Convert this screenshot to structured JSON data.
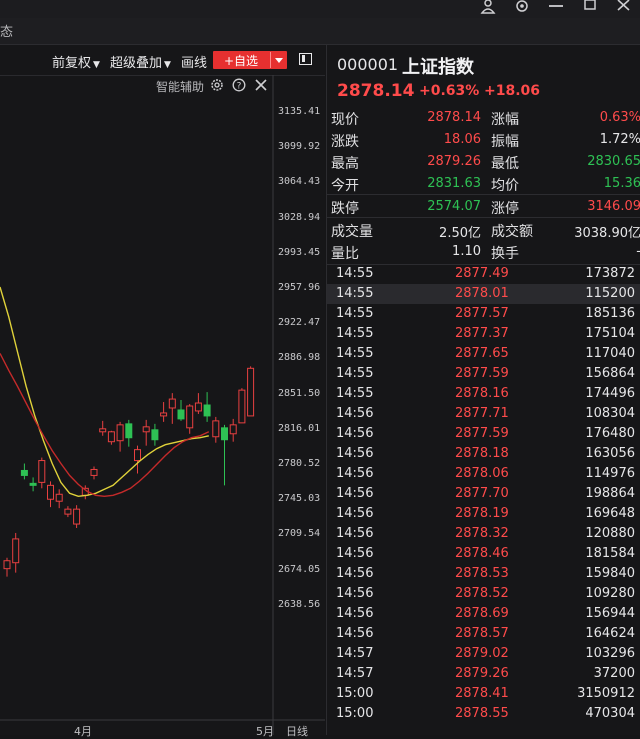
{
  "tab_label": "态",
  "toolbar": {
    "adjust": "前复权",
    "overlay": "超级叠加",
    "draw": "画线",
    "add_watch": "+自选",
    "assist": "智能辅助"
  },
  "price_axis": [
    "3135.41",
    "3099.92",
    "3064.43",
    "3028.94",
    "2993.45",
    "2957.96",
    "2922.47",
    "2886.98",
    "2851.50",
    "2816.01",
    "2780.52",
    "2745.03",
    "2709.54",
    "2674.05",
    "2638.56"
  ],
  "x_axis": {
    "month1": "4月",
    "month2": "5月",
    "period": "日线"
  },
  "stock": {
    "code": "000001",
    "name": "上证指数",
    "price": "2878.14",
    "change_pct": "+0.63%",
    "change_amt": "+18.06"
  },
  "quote_rows": [
    {
      "l1": "现价",
      "v1": "2878.14",
      "c1": "red",
      "l2": "涨幅",
      "v2": "0.63%",
      "c2": "red"
    },
    {
      "l1": "涨跌",
      "v1": "18.06",
      "c1": "red",
      "l2": "振幅",
      "v2": "1.72%",
      "c2": "white"
    },
    {
      "l1": "最高",
      "v1": "2879.26",
      "c1": "red",
      "l2": "最低",
      "v2": "2830.65",
      "c2": "green"
    },
    {
      "l1": "今开",
      "v1": "2831.63",
      "c1": "green",
      "l2": "均价",
      "v2": "15.36",
      "c2": "green"
    },
    {
      "l1": "跌停",
      "v1": "2574.07",
      "c1": "green",
      "l2": "涨停",
      "v2": "3146.09",
      "c2": "red"
    },
    {
      "l1": "成交量",
      "v1": "2.50亿",
      "c1": "white",
      "l2": "成交额",
      "v2": "3038.90亿",
      "c2": "white"
    },
    {
      "l1": "量比",
      "v1": "1.10",
      "c1": "white",
      "l2": "换手",
      "v2": "-",
      "c2": "white"
    }
  ],
  "ticks": [
    {
      "t": "14:55",
      "p": "2877.49",
      "v": "173872"
    },
    {
      "t": "14:55",
      "p": "2878.01",
      "v": "115200"
    },
    {
      "t": "14:55",
      "p": "2877.57",
      "v": "185136"
    },
    {
      "t": "14:55",
      "p": "2877.37",
      "v": "175104"
    },
    {
      "t": "14:55",
      "p": "2877.65",
      "v": "117040"
    },
    {
      "t": "14:55",
      "p": "2877.59",
      "v": "156864"
    },
    {
      "t": "14:55",
      "p": "2878.16",
      "v": "174496"
    },
    {
      "t": "14:56",
      "p": "2877.71",
      "v": "108304"
    },
    {
      "t": "14:56",
      "p": "2877.59",
      "v": "176480"
    },
    {
      "t": "14:56",
      "p": "2878.18",
      "v": "163056"
    },
    {
      "t": "14:56",
      "p": "2878.06",
      "v": "114976"
    },
    {
      "t": "14:56",
      "p": "2877.70",
      "v": "198864"
    },
    {
      "t": "14:56",
      "p": "2878.19",
      "v": "169648"
    },
    {
      "t": "14:56",
      "p": "2878.32",
      "v": "120880"
    },
    {
      "t": "14:56",
      "p": "2878.46",
      "v": "181584"
    },
    {
      "t": "14:56",
      "p": "2878.53",
      "v": "159840"
    },
    {
      "t": "14:56",
      "p": "2878.52",
      "v": "109280"
    },
    {
      "t": "14:56",
      "p": "2878.69",
      "v": "156944"
    },
    {
      "t": "14:56",
      "p": "2878.57",
      "v": "164624"
    },
    {
      "t": "14:57",
      "p": "2879.02",
      "v": "103296"
    },
    {
      "t": "14:57",
      "p": "2879.26",
      "v": "37200"
    },
    {
      "t": "15:00",
      "p": "2878.41",
      "v": "3150912"
    },
    {
      "t": "15:00",
      "p": "2878.55",
      "v": "470304"
    }
  ],
  "candles": [
    {
      "o": 2676,
      "h": 2687,
      "l": 2668,
      "c": 2684
    },
    {
      "o": 2682,
      "h": 2712,
      "l": 2672,
      "c": 2706
    },
    {
      "o": 2775,
      "h": 2782,
      "l": 2766,
      "c": 2770
    },
    {
      "o": 2762,
      "h": 2768,
      "l": 2754,
      "c": 2760
    },
    {
      "o": 2763,
      "h": 2788,
      "l": 2757,
      "c": 2785
    },
    {
      "o": 2746,
      "h": 2764,
      "l": 2738,
      "c": 2760
    },
    {
      "o": 2744,
      "h": 2756,
      "l": 2737,
      "c": 2751
    },
    {
      "o": 2731,
      "h": 2739,
      "l": 2728,
      "c": 2736
    },
    {
      "o": 2721,
      "h": 2740,
      "l": 2717,
      "c": 2736
    },
    {
      "o": 2750,
      "h": 2760,
      "l": 2746,
      "c": 2757
    },
    {
      "o": 2770,
      "h": 2779,
      "l": 2766,
      "c": 2776
    },
    {
      "o": 2814,
      "h": 2825,
      "l": 2810,
      "c": 2817
    },
    {
      "o": 2804,
      "h": 2815,
      "l": 2801,
      "c": 2814
    },
    {
      "o": 2805,
      "h": 2824,
      "l": 2794,
      "c": 2821
    },
    {
      "o": 2822,
      "h": 2826,
      "l": 2799,
      "c": 2808
    },
    {
      "o": 2785,
      "h": 2800,
      "l": 2772,
      "c": 2796
    },
    {
      "o": 2814,
      "h": 2826,
      "l": 2800,
      "c": 2819
    },
    {
      "o": 2816,
      "h": 2822,
      "l": 2800,
      "c": 2806
    },
    {
      "o": 2830,
      "h": 2844,
      "l": 2824,
      "c": 2833
    },
    {
      "o": 2838,
      "h": 2853,
      "l": 2822,
      "c": 2847
    },
    {
      "o": 2836,
      "h": 2846,
      "l": 2825,
      "c": 2827
    },
    {
      "o": 2818,
      "h": 2842,
      "l": 2812,
      "c": 2840
    },
    {
      "o": 2835,
      "h": 2853,
      "l": 2832,
      "c": 2843
    },
    {
      "o": 2841,
      "h": 2854,
      "l": 2824,
      "c": 2830
    },
    {
      "o": 2809,
      "h": 2829,
      "l": 2803,
      "c": 2825
    },
    {
      "o": 2818,
      "h": 2821,
      "l": 2760,
      "c": 2806
    },
    {
      "o": 2812,
      "h": 2827,
      "l": 2804,
      "c": 2821
    },
    {
      "o": 2823,
      "h": 2858,
      "l": 2823,
      "c": 2856
    },
    {
      "o": 2830,
      "h": 2880,
      "l": 2830,
      "c": 2878
    }
  ],
  "ma_fast": [
    2960,
    2930,
    2895,
    2860,
    2830,
    2805,
    2782,
    2763,
    2752,
    2749,
    2750,
    2752,
    2756,
    2760,
    2768,
    2776,
    2784,
    2791,
    2797,
    2801,
    2803,
    2805,
    2807,
    2808,
    2810
  ],
  "ma_slow": [
    2893,
    2876,
    2860,
    2843,
    2826,
    2810,
    2795,
    2782,
    2770,
    2761,
    2754,
    2750,
    2749,
    2750,
    2753,
    2757,
    2764,
    2772,
    2781,
    2790,
    2798,
    2804,
    2808,
    2810,
    2814
  ]
}
